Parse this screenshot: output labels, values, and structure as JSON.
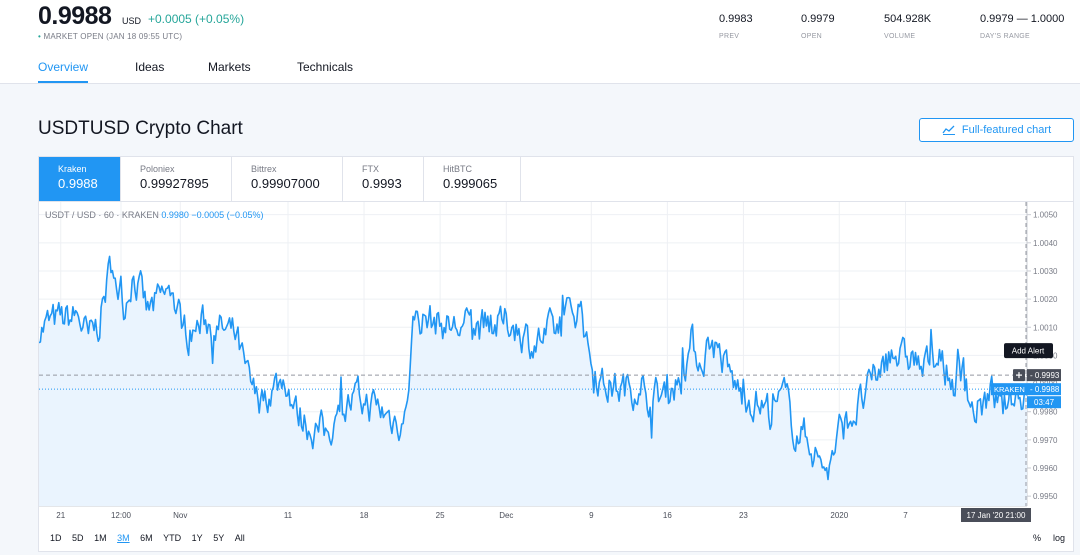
{
  "header": {
    "price": "0.9988",
    "unit": "USD",
    "change": "+0.0005 (+0.05%)",
    "status": "MARKET OPEN (JAN 18 09:55 UTC)",
    "stats": [
      {
        "value": "0.9983",
        "label": "PREV"
      },
      {
        "value": "0.9979",
        "label": "OPEN"
      },
      {
        "value": "504.928K",
        "label": "VOLUME"
      },
      {
        "value": "0.9979 — 1.0000",
        "label": "DAY'S RANGE"
      }
    ]
  },
  "nav": {
    "tabs": [
      "Overview",
      "Ideas",
      "Markets",
      "Technicals"
    ],
    "active": "Overview"
  },
  "section": {
    "title": "USDTUSD Crypto Chart",
    "full_chart_label": "Full-featured chart",
    "full_chart_icon": "chart-line-icon"
  },
  "exchanges": [
    {
      "name": "Kraken",
      "price": "0.9988",
      "active": true
    },
    {
      "name": "Poloniex",
      "price": "0.99927895",
      "active": false
    },
    {
      "name": "Bittrex",
      "price": "0.99907000",
      "active": false
    },
    {
      "name": "FTX",
      "price": "0.9993",
      "active": false
    },
    {
      "name": "HitBTC",
      "price": "0.999065",
      "active": false
    }
  ],
  "legend": {
    "symbol": "USDT / USD · 60 · KRAKEN",
    "value": "0.9980 −0.0005 (−0.05%)"
  },
  "chart_data": {
    "type": "area",
    "series_name": "USDT / USD · 60 · KRAKEN",
    "y_ticks": [
      "1.0050",
      "1.0040",
      "1.0030",
      "1.0020",
      "1.0010",
      "1.0000",
      "0.9990",
      "0.9980",
      "0.9970",
      "0.9960",
      "0.9950"
    ],
    "ylim": [
      0.99465,
      1.00545
    ],
    "x_ticks": [
      "21",
      "12:00",
      "Nov",
      "11",
      "18",
      "25",
      "Dec",
      "9",
      "16",
      "23",
      "2020",
      "7",
      "17 Jan '20  21:00"
    ],
    "grid": true,
    "colors": {
      "line": "#2196f3",
      "area": "#eaf4fe",
      "grid": "#eef0f4",
      "alert": "#131722",
      "price_badge": "#2196f3",
      "crosshair_badge": "#4a4e59"
    },
    "keypoints": [
      [
        0,
        1.001
      ],
      [
        0.02,
        1.0012
      ],
      [
        0.04,
        1.0014
      ],
      [
        0.05,
        1.0005
      ],
      [
        0.06,
        1.0011
      ],
      [
        0.075,
        1.0035
      ],
      [
        0.085,
        1.0016
      ],
      [
        0.095,
        1.003
      ],
      [
        0.11,
        1.0015
      ],
      [
        0.13,
        1.0022
      ],
      [
        0.15,
        1.0008
      ],
      [
        0.17,
        1.0012
      ],
      [
        0.19,
        1.0008
      ],
      [
        0.2,
        1.0006
      ],
      [
        0.21,
        0.9992
      ],
      [
        0.22,
        0.9984
      ],
      [
        0.235,
        0.9988
      ],
      [
        0.25,
        0.9992
      ],
      [
        0.26,
        0.998
      ],
      [
        0.275,
        0.9975
      ],
      [
        0.29,
        0.9972
      ],
      [
        0.3,
        0.9978
      ],
      [
        0.32,
        0.9984
      ],
      [
        0.34,
        0.9982
      ],
      [
        0.355,
        0.9978
      ],
      [
        0.37,
        0.9977
      ],
      [
        0.38,
        1.0014
      ],
      [
        0.4,
        1.0012
      ],
      [
        0.42,
        1.001
      ],
      [
        0.44,
        1.001
      ],
      [
        0.46,
        1.001
      ],
      [
        0.48,
        1.0012
      ],
      [
        0.5,
        1.0004
      ],
      [
        0.52,
        1.0008
      ],
      [
        0.53,
        1.001
      ],
      [
        0.54,
        1.0016
      ],
      [
        0.55,
        1.0018
      ],
      [
        0.555,
        1.0002
      ],
      [
        0.57,
        0.999
      ],
      [
        0.59,
        0.9988
      ],
      [
        0.61,
        0.999
      ],
      [
        0.62,
        0.9984
      ],
      [
        0.635,
        0.9988
      ],
      [
        0.65,
        0.9992
      ],
      [
        0.66,
        1.0004
      ],
      [
        0.67,
        0.9998
      ],
      [
        0.68,
        1.0006
      ],
      [
        0.69,
        1.0
      ],
      [
        0.7,
        0.9992
      ],
      [
        0.71,
        0.9986
      ],
      [
        0.725,
        0.9984
      ],
      [
        0.74,
        0.998
      ],
      [
        0.755,
        0.9985
      ],
      [
        0.765,
        0.9974
      ],
      [
        0.78,
        0.997
      ],
      [
        0.79,
        0.9962
      ],
      [
        0.8,
        0.996
      ],
      [
        0.81,
        0.9972
      ],
      [
        0.82,
        0.9978
      ],
      [
        0.835,
        0.9984
      ],
      [
        0.85,
        0.9994
      ],
      [
        0.865,
        1.0002
      ],
      [
        0.875,
        0.9998
      ],
      [
        0.885,
        1.0
      ],
      [
        0.895,
        0.9994
      ],
      [
        0.905,
        1.0
      ],
      [
        0.915,
        0.9996
      ],
      [
        0.925,
        0.999
      ],
      [
        0.935,
        0.9995
      ],
      [
        0.945,
        0.998
      ],
      [
        0.955,
        0.9982
      ],
      [
        0.965,
        0.9986
      ],
      [
        0.975,
        0.998
      ],
      [
        0.985,
        0.9985
      ],
      [
        1.0,
        0.9988
      ]
    ]
  },
  "overlay": {
    "alert_label": "Add Alert",
    "crosshair_price": "0.9993",
    "last_exchange": "KRAKEN",
    "last_price": "0.9988",
    "countdown": "03:47"
  },
  "ranges": [
    "1D",
    "5D",
    "1M",
    "3M",
    "6M",
    "YTD",
    "1Y",
    "5Y",
    "All"
  ],
  "active_range": "3M",
  "options": {
    "percent": "%",
    "log": "log"
  }
}
